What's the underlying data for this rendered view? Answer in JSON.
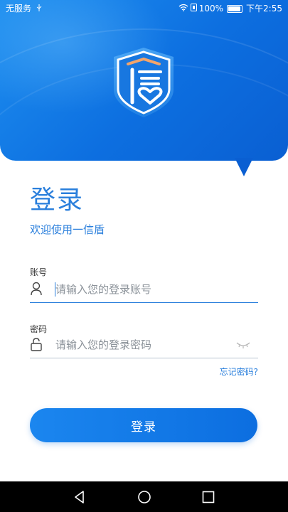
{
  "status_bar": {
    "carrier": "无服务",
    "battery_percent": "100%",
    "time": "下午2:55"
  },
  "logo": {
    "icon": "xin-shield-logo-icon"
  },
  "login": {
    "title": "登录",
    "subtitle": "欢迎使用一信盾",
    "account_label": "账号",
    "account_placeholder": "请输入您的登录账号",
    "password_label": "密码",
    "password_placeholder": "请输入您的登录密码",
    "forgot_password": "忘记密码?",
    "submit_label": "登录"
  },
  "navigation_bar": {
    "buttons": [
      "back-icon",
      "home-icon",
      "recents-icon"
    ]
  },
  "colors": {
    "accent": "#2a7fdc",
    "header_blue": "#0d6fe0",
    "button_blue": "#1b86ef"
  }
}
